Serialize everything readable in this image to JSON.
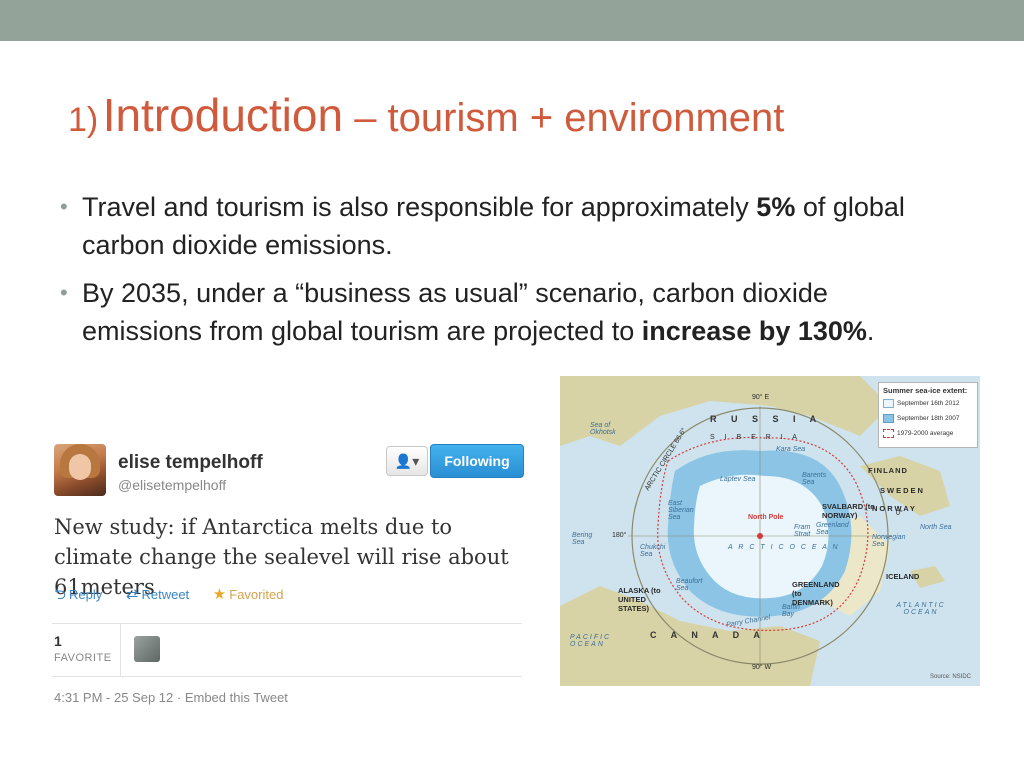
{
  "slide": {
    "title_number": "1)",
    "title_main": "Introduction",
    "title_rest": " – tourism + environment",
    "bullet_char": "•",
    "bullets": [
      {
        "pre": "Travel and tourism is also responsible for approximately ",
        "bold": "5%",
        "post": " of global carbon dioxide emissions."
      },
      {
        "pre": "By 2035, under a “business as usual” scenario, carbon dioxide emissions from global tourism are projected to ",
        "bold": "increase by 130%",
        "post": "."
      }
    ]
  },
  "tweet": {
    "name": "elise tempelhoff",
    "handle": "@elisetempelhoff",
    "follow_label": "Following",
    "user_menu_glyph": "👤▾",
    "text": "New study: if Antarctica melts due to climate change the sealevel will rise about 61meters",
    "actions": {
      "reply": "Reply",
      "retweet": "Retweet",
      "favorited": "Favorited"
    },
    "favorite_count": "1",
    "favorite_label": "FAVORITE",
    "date": "4:31 PM - 25 Sep 12 ·",
    "embed": "Embed this Tweet"
  },
  "map": {
    "legend_title": "Summer sea-ice extent:",
    "legend_items": [
      {
        "label": "September 16th 2012",
        "color": "#eaf6fc"
      },
      {
        "label": "September 18th 2007",
        "color": "#8cc4e6"
      },
      {
        "label": "1979-2000 average",
        "color": "#d33b3b"
      }
    ],
    "labels": {
      "russia": "R U S S I A",
      "canada": "C A N A D A",
      "siberia": "S I B E R I A",
      "arctic_ocean": "A R C T I C  O C E A N",
      "arctic_circle": "ARCTIC CIRCLE 66.6°",
      "deg90e": "90° E",
      "deg90w": "90° W",
      "deg180": "180°",
      "deg0": "0°",
      "north_pole": "North Pole",
      "sea_okhotsk": "Sea of Okhotsk",
      "bering_sea": "Bering Sea",
      "kara_sea": "Kara Sea",
      "barents_sea": "Barents Sea",
      "east_siberian_sea": "East Siberian Sea",
      "laptev_sea": "Laptev Sea",
      "chukchi_sea": "Chukchi Sea",
      "beaufort_sea": "Beaufort Sea",
      "baffin_bay": "Baffin Bay",
      "greenland_sea": "Greenland Sea",
      "norwegian_sea": "Norwegian Sea",
      "north_sea": "North Sea",
      "fram_strait": "Fram Strait",
      "svalbard": "SVALBARD (to NORWAY)",
      "finland": "FINLAND",
      "sweden": "SWEDEN",
      "norway": "NORWAY",
      "iceland": "ICELAND",
      "greenland": "GREENLAND (to DENMARK)",
      "alaska": "ALASKA (to UNITED STATES)",
      "parry_channel": "Parry Channel",
      "pacific_ocean": "PACIFIC OCEAN",
      "atlantic_ocean": "ATLANTIC OCEAN",
      "source": "Source: NSIDC"
    }
  }
}
